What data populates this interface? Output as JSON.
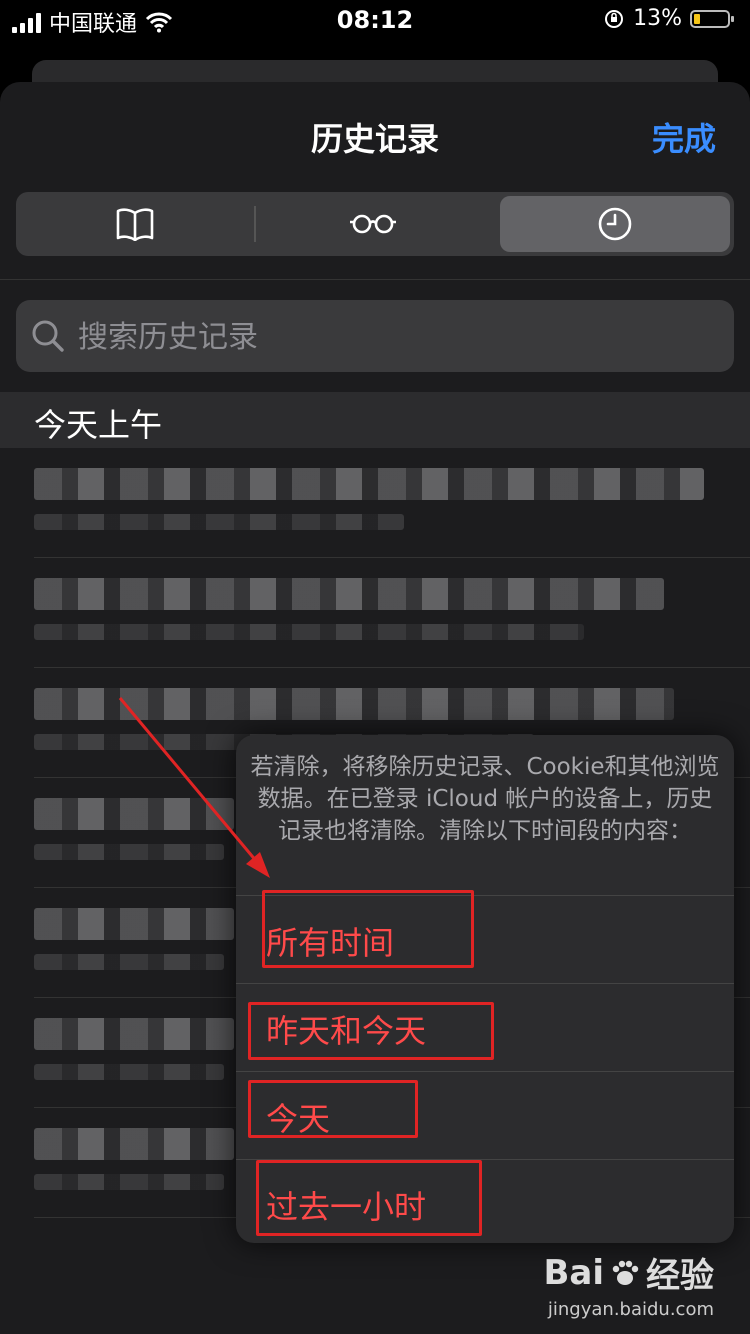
{
  "status_bar": {
    "carrier": "中国联通",
    "time": "08:12",
    "battery_percent": "13%",
    "battery_level": 0.13
  },
  "header": {
    "title": "历史记录",
    "done_label": "完成"
  },
  "tabs": [
    {
      "icon": "book-icon",
      "selected": false
    },
    {
      "icon": "reading-list-glasses-icon",
      "selected": false
    },
    {
      "icon": "history-clock-icon",
      "selected": true
    }
  ],
  "search": {
    "placeholder": "搜索历史记录"
  },
  "history": {
    "section_title": "今天上午"
  },
  "clear_sheet": {
    "message": "若清除，将移除历史记录、Cookie和其他浏览数据。在已登录 iCloud 帐户的设备上，历史记录也将清除。清除以下时间段的内容：",
    "options": [
      "所有时间",
      "昨天和今天",
      "今天",
      "过去一小时"
    ]
  },
  "watermark": {
    "brand": "Bai",
    "brand_suffix": "经验",
    "url": "jingyan.baidu.com"
  },
  "colors": {
    "accent_blue": "#3a8dff",
    "destructive_red": "#ff4a4a",
    "annotation_red": "#e02424"
  }
}
